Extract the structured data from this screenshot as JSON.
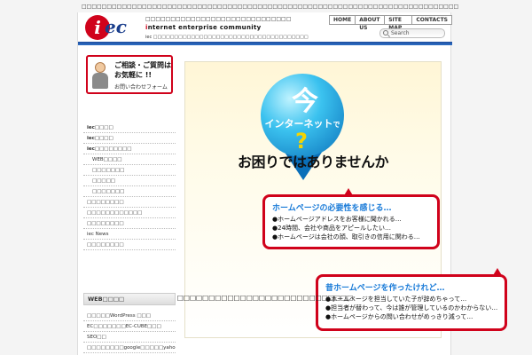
{
  "tagline": "□□□□□□□□□□□□□□□□□□□□□□□□□□□□□□□□□□□□□□□□□□□□□□□□□□□□□□□□□□□□□□□□□□□□□□□□□□□",
  "logo": {
    "letter": "i",
    "text": "ec"
  },
  "site": {
    "title": "□□□□□□□□□□□□□□□□□□□□□□□□□□□□□",
    "name_accent": "i",
    "name_rest": "nternet enterprise community",
    "sub": "iec □□□□□□□□□□□□□□□□□□□□□□□□□□□□□□□□□□□□□"
  },
  "topnav": [
    "HOME",
    "ABOUT US",
    "SITE MAP",
    "CONTACTS"
  ],
  "search": {
    "placeholder": "Search"
  },
  "consult": {
    "line1": "ご相談・ご質問は",
    "line2": "お気軽に !!",
    "line3": "お問い合わせフォーム"
  },
  "menu1": [
    "iec□□□□",
    "iec□□□□",
    "iec□□□□□□□□",
    "WEB□□□□",
    "□□□□□□□",
    "□□□□□",
    "□□□□□□□",
    "□□□□□□□□",
    "□□□□□□□□□□□□",
    "□□□□□□□□",
    "iec News",
    "□□□□□□□□"
  ],
  "menu2_title": "WEB□□□□",
  "menu2": [
    "□□□□□WordPress □□□",
    "EC□□□□□□□EC-CUBE□□□",
    "SEO□□",
    "□□□□□□□□google□□□□□yahoo□□"
  ],
  "hero": {
    "ima": "今",
    "inet": "インターネット",
    "inet_de": "で",
    "question": "?",
    "headline": "お困りではありませんか",
    "bubble1": {
      "title": "ホームページの必要性を感じる…",
      "items": [
        "●ホームページアドレスをお客様に聞かれる…",
        "●24時間、会社や商品をアピールしたい…",
        "●ホームページは会社の顔、取引きの信用に関わる…"
      ]
    },
    "bubble2": {
      "title": "昔ホームページを作ったけれど…",
      "items": [
        "●ホームページを担当していた子が辞めちゃって…",
        "●担当者が替わって、今は誰が管理しているのかわからない…",
        "●ホームページからの問い合わせがめっきり減って…"
      ]
    }
  },
  "caption": "□□□□□□□□□□□□□□□□□□□□□□□□□□□□"
}
